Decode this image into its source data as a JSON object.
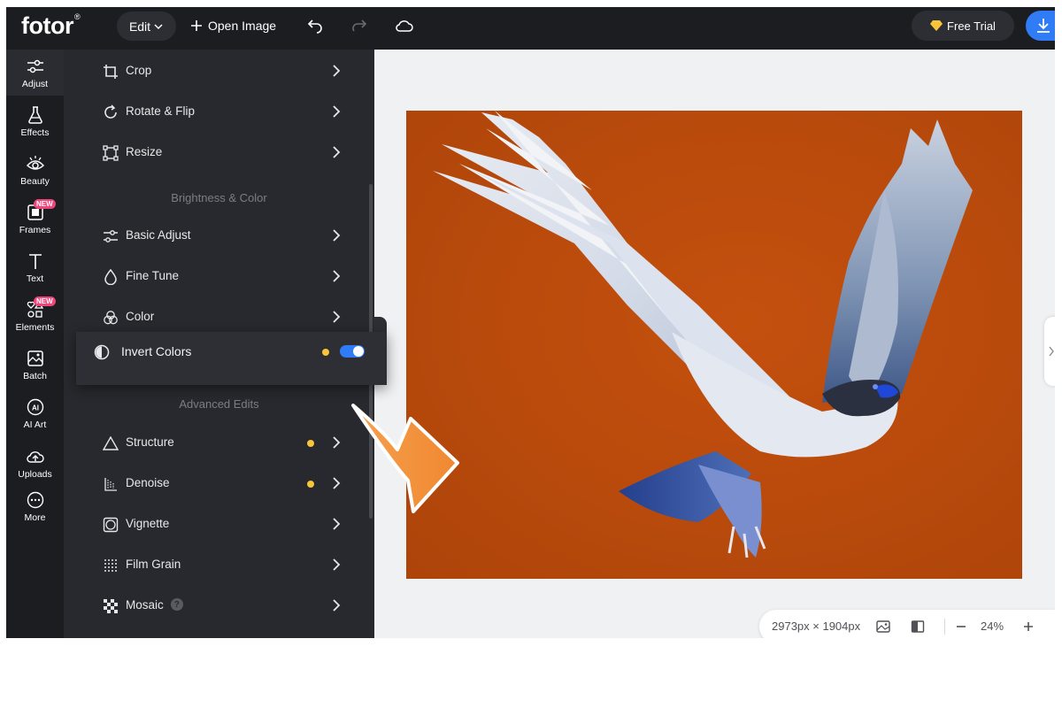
{
  "topbar": {
    "logo": "fotor",
    "logo_mark": "®",
    "edit_label": "Edit",
    "open_image_label": "Open Image",
    "free_trial_label": "Free Trial",
    "accent_color": "#2f7cf6"
  },
  "rail": {
    "items": [
      {
        "label": "Adjust",
        "icon": "sliders-icon"
      },
      {
        "label": "Effects",
        "icon": "flask-icon"
      },
      {
        "label": "Beauty",
        "icon": "eye-icon"
      },
      {
        "label": "Frames",
        "icon": "frame-icon",
        "badge": "NEW"
      },
      {
        "label": "Text",
        "icon": "text-icon"
      },
      {
        "label": "Elements",
        "icon": "shapes-icon",
        "badge": "NEW"
      },
      {
        "label": "Batch",
        "icon": "batch-icon"
      },
      {
        "label": "AI Art",
        "icon": "ai-icon"
      },
      {
        "label": "Uploads",
        "icon": "cloud-upload-icon"
      },
      {
        "label": "More",
        "icon": "more-icon"
      }
    ]
  },
  "panel": {
    "items": [
      {
        "label": "Crop",
        "icon": "crop-icon"
      },
      {
        "label": "Rotate & Flip",
        "icon": "rotate-icon"
      },
      {
        "label": "Resize",
        "icon": "resize-icon"
      }
    ],
    "section_brightness": "Brightness & Color",
    "brightness_items": [
      {
        "label": "Basic Adjust",
        "icon": "sliders-icon"
      },
      {
        "label": "Fine Tune",
        "icon": "droplet-icon"
      },
      {
        "label": "Color",
        "icon": "color-circles-icon"
      }
    ],
    "invert": {
      "label": "Invert Colors",
      "enabled": true,
      "icon": "invert-icon"
    },
    "section_advanced": "Advanced Edits",
    "advanced_items": [
      {
        "label": "Structure",
        "icon": "triangle-icon",
        "dot": true
      },
      {
        "label": "Denoise",
        "icon": "denoise-icon",
        "dot": true
      },
      {
        "label": "Vignette",
        "icon": "vignette-icon"
      },
      {
        "label": "Film Grain",
        "icon": "grain-icon"
      },
      {
        "label": "Mosaic",
        "icon": "mosaic-icon",
        "help": "?"
      }
    ],
    "dot_color": "#f8c538"
  },
  "canvas": {
    "background_color": "#c04d0d",
    "dimensions": "2973px × 1904px",
    "zoom": "24%"
  }
}
